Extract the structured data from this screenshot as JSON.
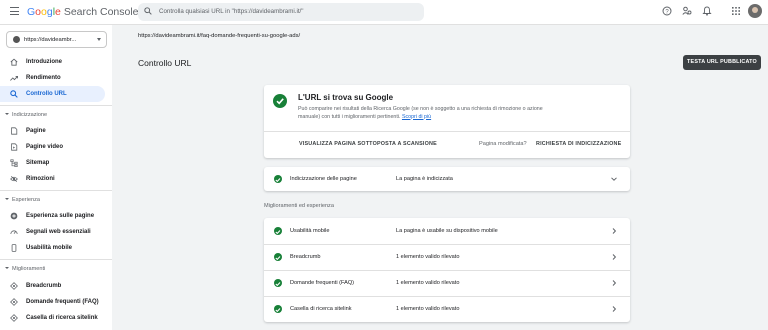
{
  "app": {
    "logo_google": "Google",
    "logo_product": "Search Console"
  },
  "search": {
    "placeholder": "Controlla qualsiasi URL in \"https://davideambrami.it/\""
  },
  "property": {
    "label": "https://davideambr..."
  },
  "sidebar": {
    "items": [
      {
        "label": "Introduzione",
        "icon": "home-icon"
      },
      {
        "label": "Rendimento",
        "icon": "trending-icon"
      },
      {
        "label": "Controllo URL",
        "icon": "search-icon",
        "active": true
      }
    ],
    "sections": [
      {
        "title": "Indicizzazione",
        "items": [
          {
            "label": "Pagine",
            "icon": "page-icon"
          },
          {
            "label": "Pagine video",
            "icon": "video-page-icon"
          },
          {
            "label": "Sitemap",
            "icon": "sitemap-icon"
          },
          {
            "label": "Rimozioni",
            "icon": "removal-icon"
          }
        ]
      },
      {
        "title": "Esperienza",
        "items": [
          {
            "label": "Esperienza sulle pagine",
            "icon": "plus-circle-icon"
          },
          {
            "label": "Segnali web essenziali",
            "icon": "speed-icon"
          },
          {
            "label": "Usabilità mobile",
            "icon": "phone-icon"
          }
        ]
      },
      {
        "title": "Miglioramenti",
        "items": [
          {
            "label": "Breadcrumb",
            "icon": "diamond-icon"
          },
          {
            "label": "Domande frequenti (FAQ)",
            "icon": "diamond-icon"
          },
          {
            "label": "Casella di ricerca sitelink",
            "icon": "diamond-icon"
          }
        ]
      }
    ]
  },
  "main": {
    "url": "https://davideambrami.it/faq-domande-frequenti-su-google-ads/",
    "title": "Controllo URL",
    "test_button": "TESTA URL PUBBLICATO",
    "status_card": {
      "title": "L'URL si trova su Google",
      "description": "Può comparire nei risultati della Ricerca Google (se non è soggetto a una richiesta di rimozione o azione manuale) con tutti i miglioramenti pertinenti.",
      "learn_more": "Scopri di più",
      "view_crawled": "VISUALIZZA PAGINA SOTTOPOSTA A SCANSIONE",
      "page_modified": "Pagina modificata?",
      "request_indexing": "RICHIESTA DI INDICIZZAZIONE"
    },
    "indexing_row": {
      "label": "Indicizzazione delle pagine",
      "value": "La pagina è indicizzata"
    },
    "enhancements_title": "Miglioramenti ed esperienza",
    "enhancements": [
      {
        "label": "Usabilità mobile",
        "value": "La pagina è usabile su dispositivo mobile"
      },
      {
        "label": "Breadcrumb",
        "value": "1 elemento valido rilevato"
      },
      {
        "label": "Domande frequenti (FAQ)",
        "value": "1 elemento valido rilevato"
      },
      {
        "label": "Casella di ricerca sitelink",
        "value": "1 elemento valido rilevato"
      }
    ]
  },
  "colors": {
    "accent": "#1967d2",
    "success": "#188038",
    "active_bg": "#e8f0fe"
  }
}
